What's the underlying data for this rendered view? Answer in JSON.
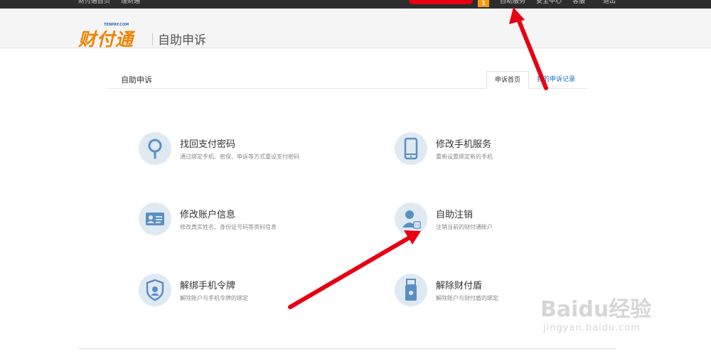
{
  "topbar": {
    "links": [
      "财付通首页",
      "理财通"
    ],
    "badge": "1",
    "right_links": [
      "自助服务",
      "安全中心",
      "客服",
      "退出"
    ]
  },
  "header": {
    "logo_brand": "财付通",
    "logo_small": "TENPAY.COM",
    "section_title": "自助申诉"
  },
  "panel": {
    "title": "自助申诉",
    "tabs": [
      "申诉首页",
      "我的申诉记录"
    ]
  },
  "services": [
    {
      "title": "找回支付密码",
      "desc": "通过绑定手机、密保、申诉等方式重设支付密码",
      "icon": "magnifier-icon"
    },
    {
      "title": "修改手机服务",
      "desc": "重新设置绑定新的手机",
      "icon": "phone-icon"
    },
    {
      "title": "修改账户信息",
      "desc": "修改真实姓名、身份证号码等资料信息",
      "icon": "id-card-icon"
    },
    {
      "title": "自助注销",
      "desc": "注销当前的财付通账户",
      "icon": "user-delete-icon"
    },
    {
      "title": "解绑手机令牌",
      "desc": "解除账户与手机令牌的绑定",
      "icon": "token-shield-icon"
    },
    {
      "title": "解除财付盾",
      "desc": "解除账户与财付盾的绑定",
      "icon": "usb-key-icon"
    }
  ],
  "watermark": {
    "line1": "Baidu经验",
    "line2": "jingyan.baidu.com"
  },
  "colors": {
    "accent_orange": "#f08300",
    "link_blue": "#1a6ebd",
    "icon_bg": "#dfe9f2",
    "icon_fg": "#5b8fc4",
    "arrow_red": "#e60012"
  }
}
